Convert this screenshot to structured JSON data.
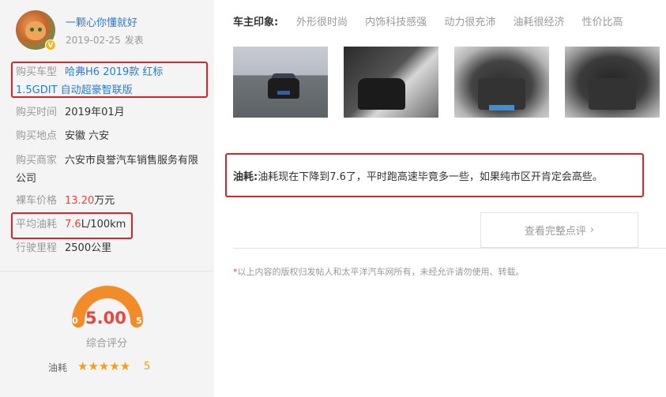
{
  "user": {
    "name": "一颗心你懂就好",
    "date": "2019-02-25",
    "post_label": "发表",
    "badge": "V"
  },
  "info": {
    "model_label": "购买车型",
    "model_value": "哈弗H6 2019款 红标 1.5GDIT 自动超豪智联版",
    "time_label": "购买时间",
    "time_value": "2019年01月",
    "place_label": "购买地点",
    "place_value": "安徽 六安",
    "dealer_label": "购买商家",
    "dealer_value": "六安市良誉汽车销售服务有限公司",
    "price_label": "裸车价格",
    "price_num": "13.20",
    "price_unit": "万元",
    "fuel_label": "平均油耗",
    "fuel_num": "7.6",
    "fuel_unit": "L/100km",
    "mileage_label": "行驶里程",
    "mileage_value": "2500公里"
  },
  "score": {
    "value": "5.00",
    "min": "0",
    "max": "5",
    "label": "综合评分",
    "level": 1.0
  },
  "fuel_rating": {
    "label": "油耗",
    "stars": "★★★★★",
    "value": "5"
  },
  "impression": {
    "label": "车主印象:",
    "tags": [
      "外形很时尚",
      "内饰科技感强",
      "动力很充沛",
      "油耗很经济",
      "性价比高"
    ]
  },
  "comment": {
    "label": "油耗:",
    "text": "油耗现在下降到7.6了，平时跑高速毕竟多一些，如果纯市区开肯定会高些。"
  },
  "view_full": {
    "label": "查看完整点评",
    "chevron": "›"
  },
  "disclaimer": {
    "asterisk": "*",
    "text": "以上内容的版权归发帖人和太平洋汽车网所有，未经允许请勿使用、转载。"
  },
  "colors": {
    "accent_red": "#e8463f",
    "link_blue": "#2a7bd6",
    "star_orange": "#f1a01c",
    "gauge_orange": "#f28c28",
    "highlight_box": "#d8232a"
  }
}
